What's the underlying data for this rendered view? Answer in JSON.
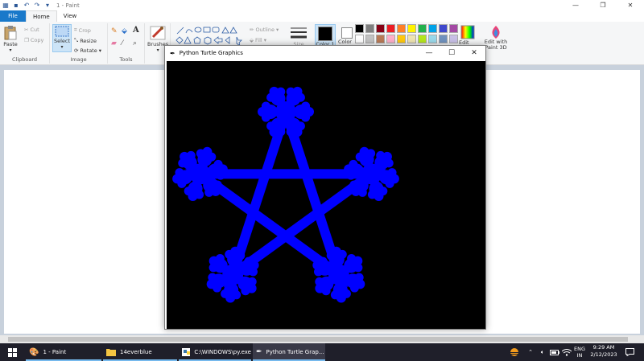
{
  "paint": {
    "window_title": "1 - Paint",
    "tabs": [
      {
        "label": "File"
      },
      {
        "label": "Home"
      },
      {
        "label": "View"
      }
    ],
    "clipboard": {
      "paste": "Paste",
      "cut": "Cut",
      "copy": "Copy",
      "label": "Clipboard"
    },
    "image": {
      "select": "Select",
      "crop": "Crop",
      "resize": "Resize",
      "rotate": "Rotate",
      "label": "Image"
    },
    "tools": {
      "label": "Tools",
      "text_tool": "A"
    },
    "brushes": {
      "label": "Brushes"
    },
    "shapes": {
      "outline": "Outline",
      "fill": "Fill",
      "size": "Size"
    },
    "colors": {
      "color1": "Color 1",
      "color2": "Color 2",
      "edit_colors": "Edit colors",
      "edit_paint3d": "Edit with Paint 3D",
      "palette": [
        "#000000",
        "#7f7f7f",
        "#880015",
        "#ed1c24",
        "#ff7f27",
        "#fff200",
        "#22b14c",
        "#00a2e8",
        "#3f48cc",
        "#a349a4",
        "#ffffff",
        "#c3c3c3",
        "#b97a57",
        "#ffaec9",
        "#ffc90e",
        "#efe4b0",
        "#b5e61d",
        "#99d9ea",
        "#7092be",
        "#c8bfe7"
      ]
    }
  },
  "turtle_window": {
    "title": "Python Turtle Graphics",
    "canvas_bg": "#000000",
    "drawing_color": "#0000ff"
  },
  "taskbar": {
    "items": [
      {
        "label": "1 - Paint"
      },
      {
        "label": "14everblue"
      },
      {
        "label": "C:\\WINDOWS\\py.exe"
      },
      {
        "label": "Python Turtle Grap..."
      }
    ],
    "language": "ENG",
    "region": "IN",
    "time": "9:29 AM",
    "date": "2/12/2023"
  }
}
